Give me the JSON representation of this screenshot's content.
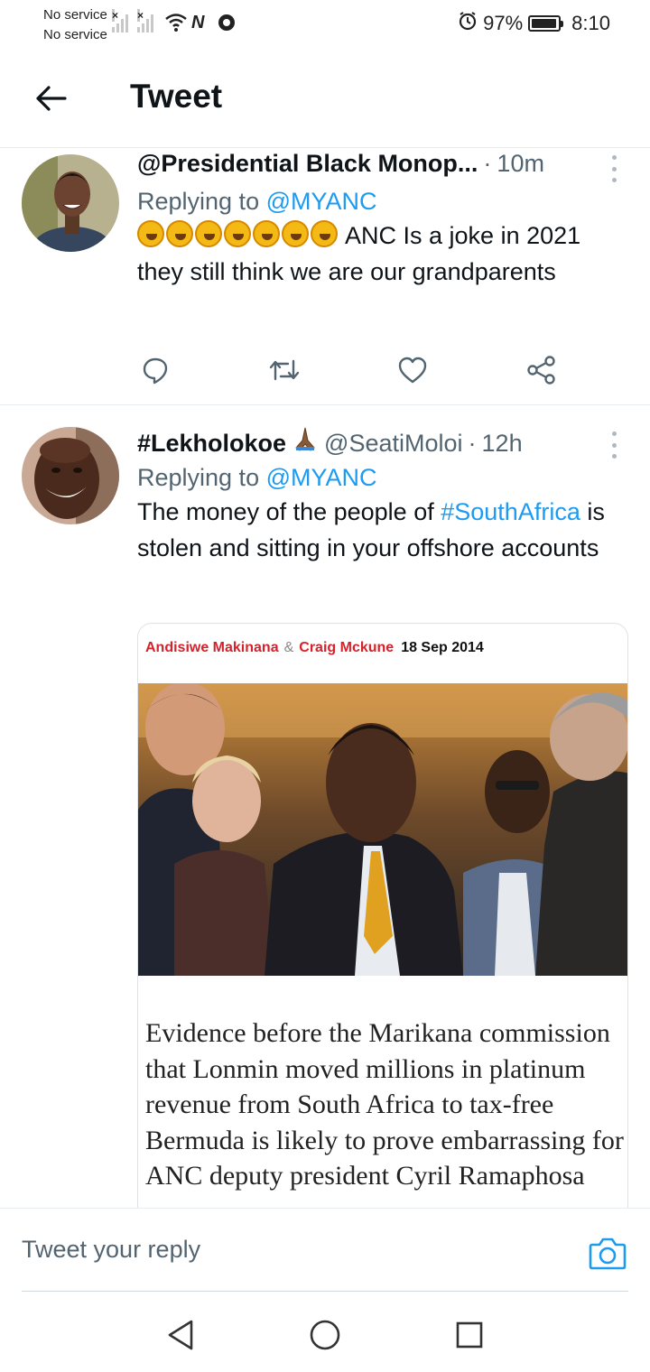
{
  "status_bar": {
    "service_line1": "No service",
    "service_line2": "No service",
    "battery_percent": "97%",
    "battery_level": 0.97,
    "time": "8:10",
    "icons": [
      "signal-icon",
      "signal-icon",
      "wifi-icon",
      "nfc-icon",
      "vpn-icon",
      "alarm-icon",
      "battery-icon"
    ]
  },
  "header": {
    "title": "Tweet",
    "back_icon": "arrow-left-icon"
  },
  "tweets": [
    {
      "display_name": "@Presidential Black Monop...",
      "handle": "",
      "time": "10m",
      "replying_prefix": "Replying to",
      "replying_to": "@MYANC",
      "emoji_count": 7,
      "text": "ANC Is a joke in 2021 they still think we are our grandparents",
      "actions": [
        "reply-icon",
        "retweet-icon",
        "like-icon",
        "share-icon"
      ]
    },
    {
      "display_name": "#Lekholokoe",
      "handle": "@SeatiMoloi",
      "time": "12h",
      "replying_prefix": "Replying to",
      "replying_to": "@MYANC",
      "text_part1": "The money of the people of",
      "hashtag": "#SouthAfrica",
      "text_part2": "is stolen and sitting in your offshore accounts",
      "card": {
        "author1": "Andisiwe Makinana",
        "amp": "&",
        "author2": "Craig Mckune",
        "date": "18 Sep 2014",
        "body": "Evidence before the Marikana commission that Lonmin moved millions in platinum revenue from South Africa to tax-free Bermuda is likely to prove embarrassing for ANC deputy president Cyril Ramaphosa"
      }
    }
  ],
  "reply_bar": {
    "placeholder": "Tweet your reply",
    "icon": "camera-icon"
  },
  "colors": {
    "accent": "#1d9bf0",
    "secondary_text": "#536471",
    "byline_red": "#d6222a"
  },
  "nav_bar": [
    "back-triangle-icon",
    "home-circle-icon",
    "recents-square-icon"
  ]
}
